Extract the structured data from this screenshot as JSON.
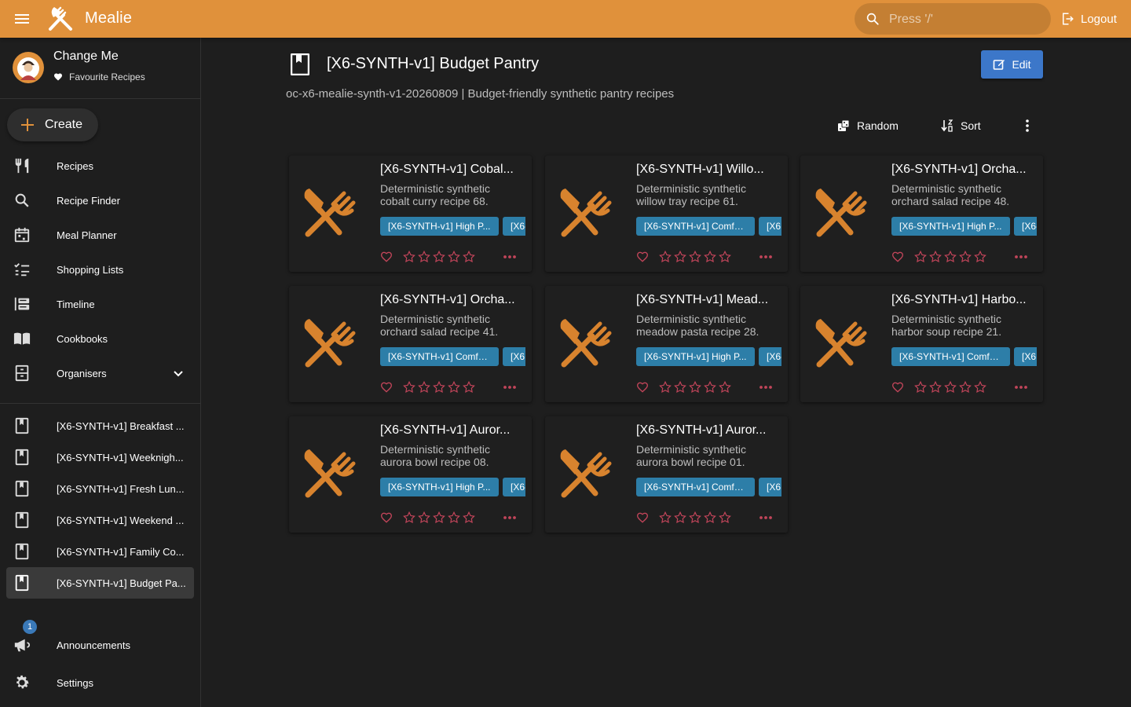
{
  "app": {
    "title": "Mealie"
  },
  "search": {
    "placeholder": "Press '/'"
  },
  "header": {
    "logout_label": "Logout"
  },
  "profile": {
    "name": "Change Me",
    "favourites_label": "Favourite Recipes"
  },
  "sidebar": {
    "create_label": "Create",
    "items": [
      {
        "label": "Recipes",
        "icon": "fork-knife-icon"
      },
      {
        "label": "Recipe Finder",
        "icon": "search-icon"
      },
      {
        "label": "Meal Planner",
        "icon": "calendar-icon"
      },
      {
        "label": "Shopping Lists",
        "icon": "checklist-icon"
      },
      {
        "label": "Timeline",
        "icon": "timeline-icon"
      },
      {
        "label": "Cookbooks",
        "icon": "book-open-icon"
      },
      {
        "label": "Organisers",
        "icon": "file-cabinet-icon"
      }
    ],
    "cookbooks": [
      {
        "label": "[X6-SYNTH-v1] Breakfast ..."
      },
      {
        "label": "[X6-SYNTH-v1] Weeknigh..."
      },
      {
        "label": "[X6-SYNTH-v1] Fresh Lun..."
      },
      {
        "label": "[X6-SYNTH-v1] Weekend ..."
      },
      {
        "label": "[X6-SYNTH-v1] Family Co..."
      },
      {
        "label": "[X6-SYNTH-v1] Budget Pa..."
      }
    ],
    "announcements_label": "Announcements",
    "announcements_count": "1",
    "settings_label": "Settings"
  },
  "page": {
    "title": "[X6-SYNTH-v1] Budget Pantry",
    "subtitle": "oc-x6-mealie-synth-v1-20260809 | Budget-friendly synthetic pantry recipes",
    "edit_label": "Edit",
    "random_label": "Random",
    "sort_label": "Sort"
  },
  "recipes": [
    {
      "title": "[X6-SYNTH-v1] Cobal...",
      "desc": "Deterministic synthetic cobalt curry recipe 68.",
      "tag1": "[X6-SYNTH-v1] High P...",
      "tag2": "[X6-",
      "rating": 0
    },
    {
      "title": "[X6-SYNTH-v1] Willo...",
      "desc": "Deterministic synthetic willow tray recipe 61.",
      "tag1": "[X6-SYNTH-v1] Comfor...",
      "tag2": "[X6",
      "rating": 0
    },
    {
      "title": "[X6-SYNTH-v1] Orcha...",
      "desc": "Deterministic synthetic orchard salad recipe 48.",
      "tag1": "[X6-SYNTH-v1] High P...",
      "tag2": "[X6-",
      "rating": 0
    },
    {
      "title": "[X6-SYNTH-v1] Orcha...",
      "desc": "Deterministic synthetic orchard salad recipe 41.",
      "tag1": "[X6-SYNTH-v1] Comfor...",
      "tag2": "[X6",
      "rating": 0
    },
    {
      "title": "[X6-SYNTH-v1] Mead...",
      "desc": "Deterministic synthetic meadow pasta recipe 28.",
      "tag1": "[X6-SYNTH-v1] High P...",
      "tag2": "[X6-",
      "rating": 0
    },
    {
      "title": "[X6-SYNTH-v1] Harbo...",
      "desc": "Deterministic synthetic harbor soup recipe 21.",
      "tag1": "[X6-SYNTH-v1] Comfor...",
      "tag2": "[X6",
      "rating": 0
    },
    {
      "title": "[X6-SYNTH-v1] Auror...",
      "desc": "Deterministic synthetic aurora bowl recipe 08.",
      "tag1": "[X6-SYNTH-v1] High P...",
      "tag2": "[X6-",
      "rating": 0
    },
    {
      "title": "[X6-SYNTH-v1] Auror...",
      "desc": "Deterministic synthetic aurora bowl recipe 01.",
      "tag1": "[X6-SYNTH-v1] Comfor...",
      "tag2": "[X6",
      "rating": 0
    }
  ],
  "colors": {
    "brand": "#e0913b",
    "primary": "#3c77c9",
    "tag": "#2d7ea8",
    "favorite": "#c2455a"
  }
}
